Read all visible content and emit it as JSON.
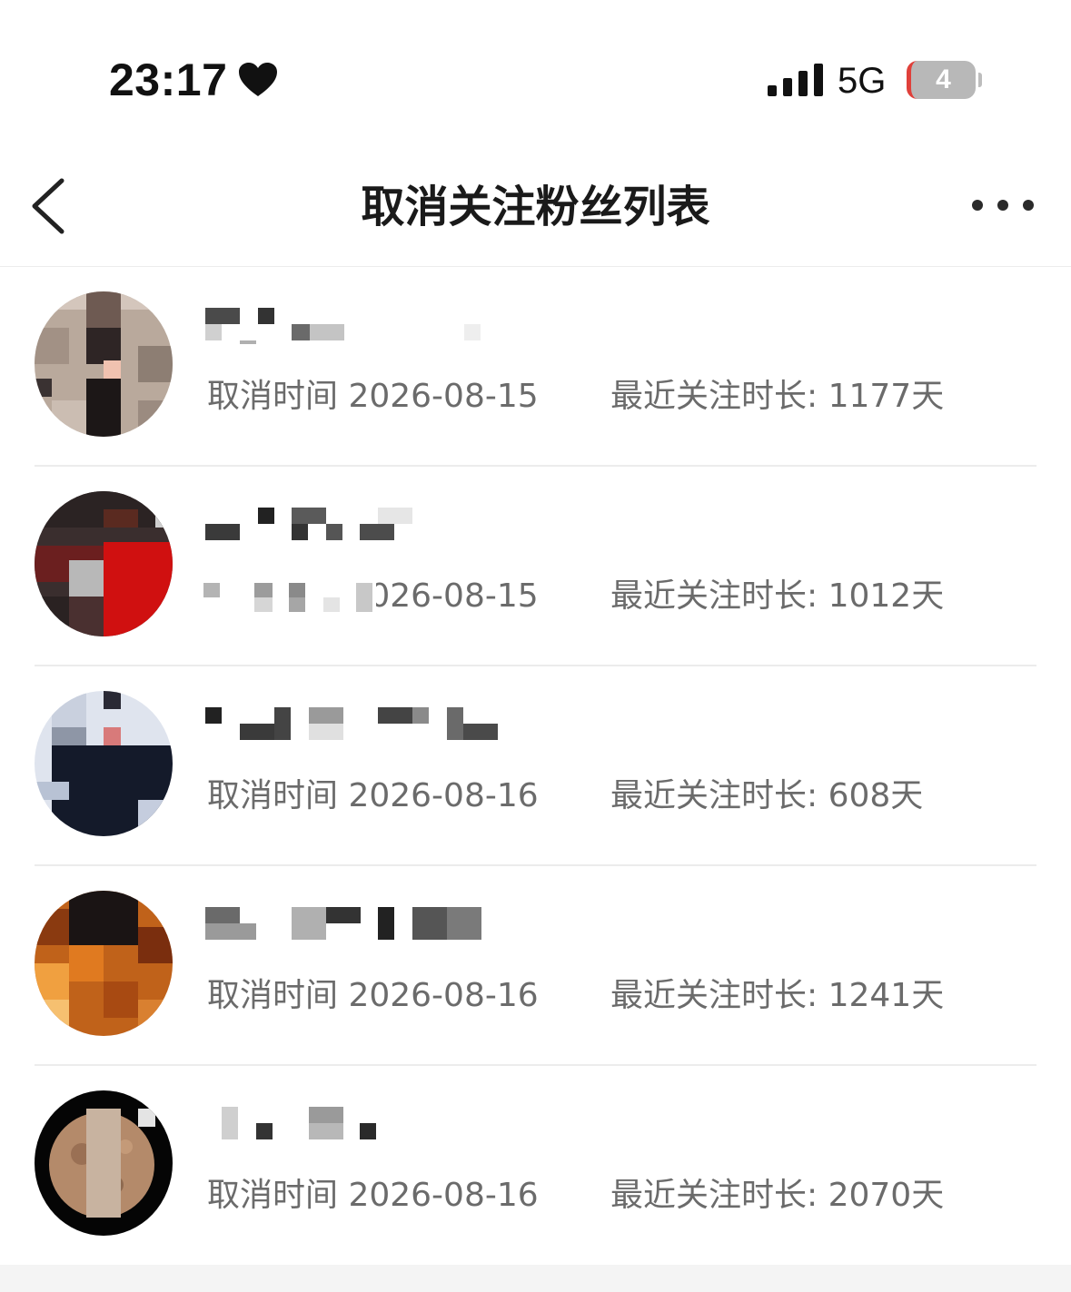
{
  "status_bar": {
    "time": "23:17",
    "network": "5G",
    "battery_level": "4"
  },
  "nav": {
    "title": "取消关注粉丝列表"
  },
  "fans": [
    {
      "cancel_label": "取消时间 2026-08-15",
      "duration_label": "最近关注时长: 1177天"
    },
    {
      "cancel_label": "取消时间 2026-08-15",
      "duration_label": "最近关注时长: 1012天"
    },
    {
      "cancel_label": "取消时间 2026-08-16",
      "duration_label": "最近关注时长: 608天"
    },
    {
      "cancel_label": "取消时间 2026-08-16",
      "duration_label": "最近关注时长: 1241天"
    },
    {
      "cancel_label": "取消时间 2026-08-16",
      "duration_label": "最近关注时长: 2070天"
    }
  ],
  "icons": {
    "heart": "heart-icon",
    "signal": "signal-icon",
    "back": "back-icon",
    "more": "more-icon"
  },
  "colors": {
    "battery_low_accent": "#e0403a",
    "meta_text": "#6b6b6b",
    "divider": "#ececec"
  }
}
